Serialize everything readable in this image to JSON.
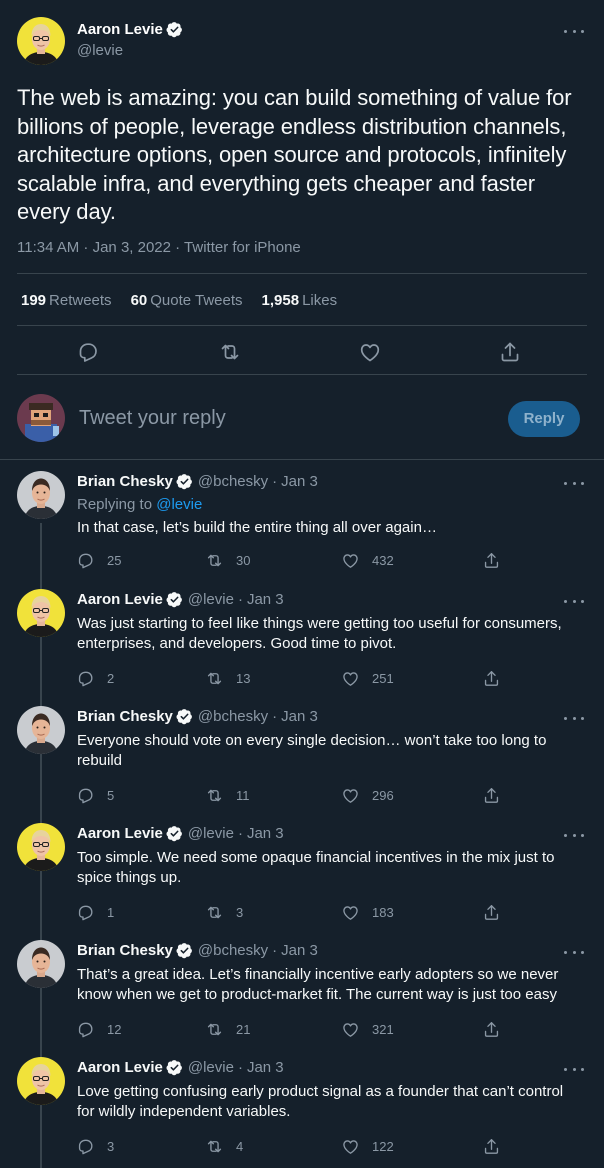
{
  "main_tweet": {
    "author_name": "Aaron Levie",
    "author_handle": "@levie",
    "text": "The web is amazing: you can build something of value for billions of people, leverage endless distribution channels, architecture options, open source and protocols, infinitely scalable infra, and everything gets cheaper and faster every day.",
    "timestamp": "11:34 AM · Jan 3, 2022 · Twitter for iPhone",
    "retweets_count": "199",
    "retweets_label": "Retweets",
    "quote_count": "60",
    "quote_label": "Quote Tweets",
    "likes_count": "1,958",
    "likes_label": "Likes"
  },
  "composer": {
    "placeholder": "Tweet your reply",
    "button_label": "Reply"
  },
  "replies": [
    {
      "name": "Brian Chesky",
      "handle": "@bchesky",
      "date": "Jan 3",
      "replying_prefix": "Replying to ",
      "replying_to": "@levie",
      "text": "In that case, let’s build the entire thing all over again…",
      "replies": "25",
      "retweets": "30",
      "likes": "432"
    },
    {
      "name": "Aaron Levie",
      "handle": "@levie",
      "date": "Jan 3",
      "text": "Was just starting to feel like things were getting too useful for consumers, enterprises, and developers. Good time to pivot.",
      "replies": "2",
      "retweets": "13",
      "likes": "251"
    },
    {
      "name": "Brian Chesky",
      "handle": "@bchesky",
      "date": "Jan 3",
      "text": "Everyone should vote on every single decision… won’t take too long to rebuild",
      "replies": "5",
      "retweets": "11",
      "likes": "296"
    },
    {
      "name": "Aaron Levie",
      "handle": "@levie",
      "date": "Jan 3",
      "text": "Too simple. We need some opaque financial incentives in the mix just to spice things up.",
      "replies": "1",
      "retweets": "3",
      "likes": "183"
    },
    {
      "name": "Brian Chesky",
      "handle": "@bchesky",
      "date": "Jan 3",
      "text": "That’s a great idea. Let’s financially incentive early adopters so we never know when we get to product-market fit. The current way is just too easy",
      "replies": "12",
      "retweets": "21",
      "likes": "321"
    },
    {
      "name": "Aaron Levie",
      "handle": "@levie",
      "date": "Jan 3",
      "text": "Love getting confusing early product signal as a founder that can’t control for wildly independent variables.",
      "replies": "3",
      "retweets": "4",
      "likes": "122"
    }
  ],
  "colors": {
    "background": "#15202b",
    "accent": "#1d9bf0",
    "muted_text": "#8b98a5",
    "divider": "#38444d"
  },
  "icons": [
    "verified-badge-icon",
    "more-icon",
    "reply-icon",
    "retweet-icon",
    "like-icon",
    "share-icon"
  ]
}
